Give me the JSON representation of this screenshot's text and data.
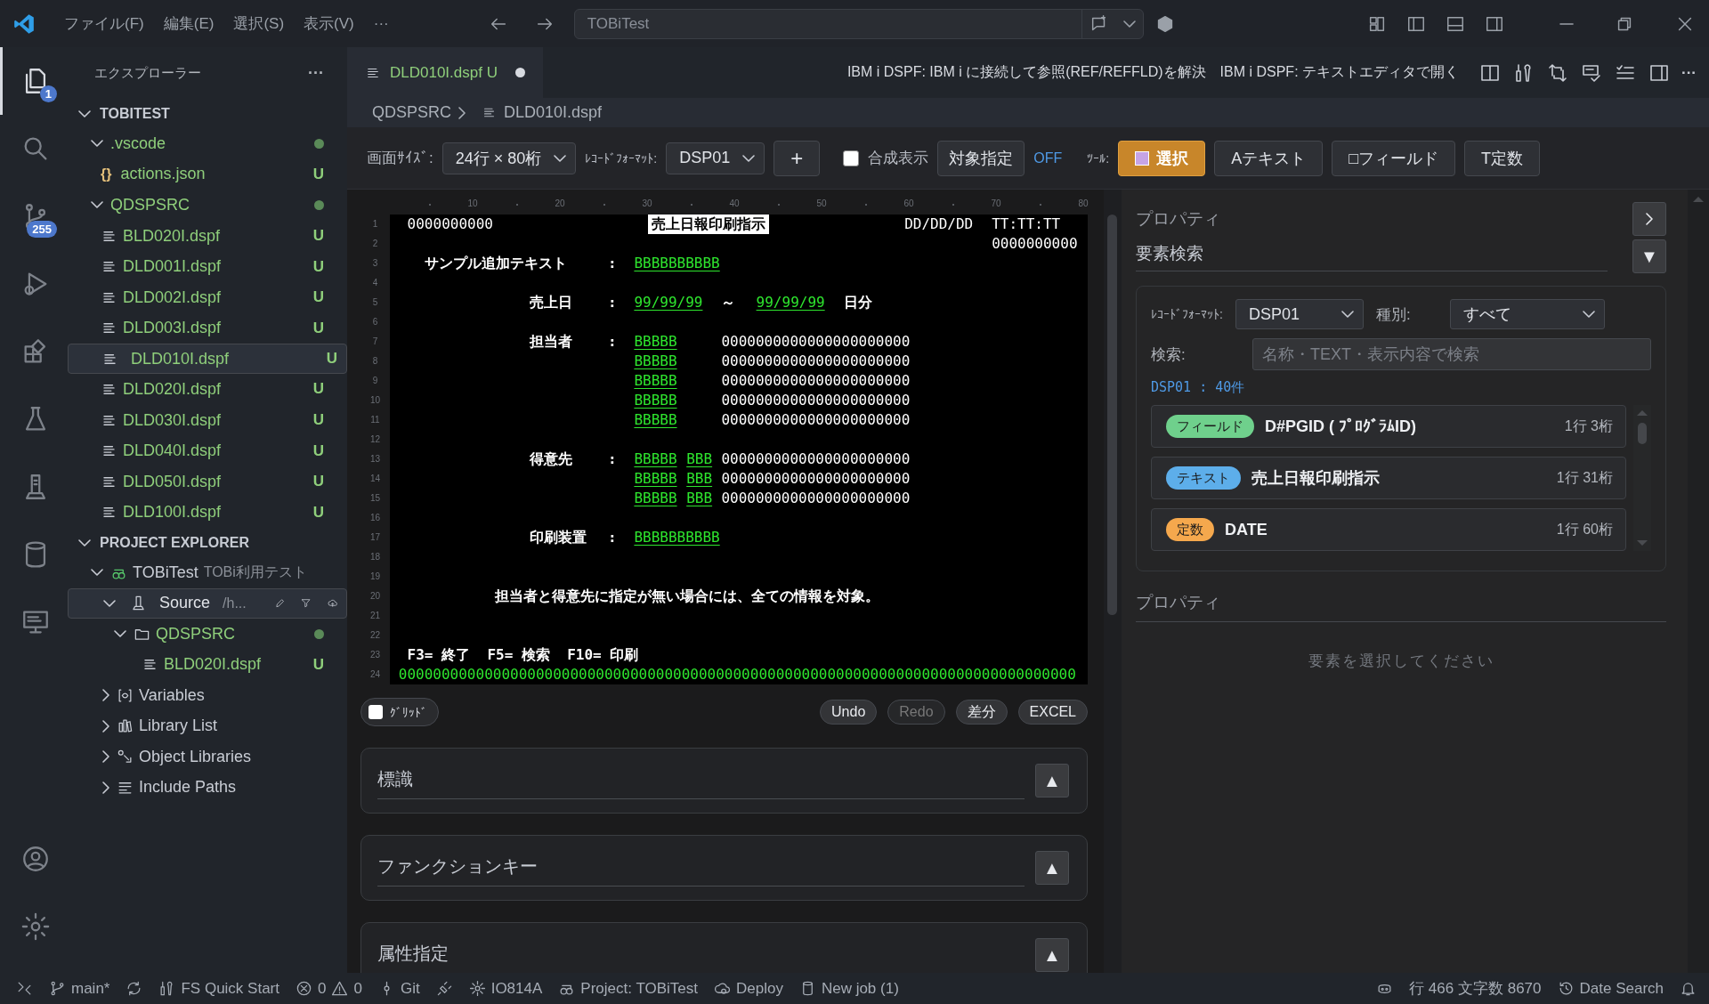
{
  "title_bar": {
    "menus": [
      "ファイル(F)",
      "編集(E)",
      "選択(S)",
      "表示(V)"
    ],
    "more": "···",
    "command_center": "TOBiTest"
  },
  "activity_bar": {
    "items": [
      {
        "selected": true,
        "badge": "1"
      },
      {
        "selected": false
      },
      {
        "selected": false,
        "badge": "255"
      },
      {
        "selected": false
      },
      {
        "selected": false
      },
      {
        "selected": false
      },
      {
        "selected": false
      },
      {
        "selected": false
      },
      {
        "selected": false
      }
    ]
  },
  "sidebar": {
    "title": "エクスプローラー",
    "more": "···",
    "sections": [
      {
        "title": "TOBITEST",
        "kind": "files",
        "expanded": true,
        "items": [
          {
            "label": ".vscode",
            "kind": "folder",
            "expanded": true,
            "dot": true,
            "selected": false,
            "children": [
              {
                "label": "actions.json",
                "kind": "json",
                "glyph": "{}",
                "badge": "U",
                "selected": false
              }
            ]
          },
          {
            "label": "QDSPSRC",
            "kind": "folder",
            "expanded": true,
            "dot": true,
            "selected": false,
            "children": [
              {
                "label": "BLD020I.dspf",
                "kind": "file",
                "badge": "U",
                "selected": false
              },
              {
                "label": "DLD001I.dspf",
                "kind": "file",
                "badge": "U",
                "selected": false
              },
              {
                "label": "DLD002I.dspf",
                "kind": "file",
                "badge": "U",
                "selected": false
              },
              {
                "label": "DLD003I.dspf",
                "kind": "file",
                "badge": "U",
                "selected": false
              },
              {
                "label": "DLD010I.dspf",
                "kind": "file",
                "badge": "U",
                "selected": true
              },
              {
                "label": "DLD020I.dspf",
                "kind": "file",
                "badge": "U",
                "selected": false
              },
              {
                "label": "DLD030I.dspf",
                "kind": "file",
                "badge": "U",
                "selected": false
              },
              {
                "label": "DLD040I.dspf",
                "kind": "file",
                "badge": "U",
                "selected": false
              },
              {
                "label": "DLD050I.dspf",
                "kind": "file",
                "badge": "U",
                "selected": false
              },
              {
                "label": "DLD100I.dspf",
                "kind": "file",
                "badge": "U",
                "selected": false
              }
            ]
          }
        ]
      },
      {
        "title": "PROJECT EXPLORER",
        "kind": "project",
        "expanded": true,
        "items": [
          {
            "label": "TOBiTest",
            "description": "TOBi利用テスト",
            "kind": "project",
            "expanded": true,
            "selected": false,
            "children": [
              {
                "label": "Source",
                "description": "/h...",
                "kind": "source",
                "expanded": true,
                "selected": true,
                "actions": true,
                "children": [
                  {
                    "label": "QDSPSRC",
                    "kind": "folder",
                    "expanded": true,
                    "dot": true,
                    "selected": false,
                    "children": [
                      {
                        "label": "BLD020I.dspf",
                        "kind": "file",
                        "badge": "U",
                        "selected": false
                      }
                    ]
                  }
                ]
              },
              {
                "label": "Variables",
                "kind": "variables",
                "expanded": false,
                "selected": false
              },
              {
                "label": "Library List",
                "kind": "library",
                "expanded": false,
                "selected": false
              },
              {
                "label": "Object Libraries",
                "kind": "objects",
                "expanded": false,
                "selected": false
              },
              {
                "label": "Include Paths",
                "kind": "include",
                "expanded": false,
                "selected": false
              }
            ]
          }
        ]
      }
    ]
  },
  "editor_tab": {
    "label": "DLD010I.dspf",
    "badge": "U",
    "modified": true,
    "selected": true
  },
  "editor_actions": [
    "IBM i DSPF: IBM i に接続して参照(REF/REFFLD)を解決",
    "IBM i DSPF: テキストエディタで開く"
  ],
  "editor_more": "···",
  "breadcrumb": [
    "QDSPSRC",
    "DLD010I.dspf"
  ],
  "toolbar": {
    "screen_size_label": "画面ｻｲｽﾞ:",
    "screen_size": "24行 × 80桁",
    "record_format_label": "ﾚｺｰﾄﾞﾌｫｰﾏｯﾄ:",
    "record_format": "DSP01",
    "add": "+",
    "composite": {
      "label": "合成表示",
      "checked": false
    },
    "target_button": "対象指定",
    "target_state": "OFF",
    "tools_label": "ﾂｰﾙ:",
    "tools": [
      {
        "label": "選択",
        "kind": "select",
        "selected": true
      },
      {
        "label": "テキスト",
        "kind": "text",
        "glyph": "A",
        "selected": false
      },
      {
        "label": "フィールド",
        "kind": "field",
        "glyph": "□",
        "selected": false
      },
      {
        "label": "定数",
        "kind": "constant",
        "glyph": "T",
        "selected": false
      }
    ]
  },
  "screen": {
    "ruler": [
      "10",
      "20",
      "30",
      "40",
      "50",
      "60",
      "70",
      "80"
    ],
    "line_numbers": [
      "1",
      "2",
      "3",
      "4",
      "5",
      "6",
      "7",
      "8",
      "9",
      "10",
      "11",
      "12",
      "13",
      "14",
      "15",
      "16",
      "17",
      "18",
      "19",
      "20",
      "21",
      "22",
      "23",
      "24"
    ],
    "fields": [
      {
        "kind": "output",
        "text": "0000000000"
      },
      {
        "kind": "reverse",
        "text": "売上日報印刷指示"
      },
      {
        "kind": "output",
        "text": "DD/DD/DD"
      },
      {
        "kind": "output",
        "text": "TT:TT:TT"
      },
      {
        "kind": "output",
        "text": "0000000000"
      },
      {
        "kind": "constant",
        "text": "サンプル追加テキスト"
      },
      {
        "kind": "constant",
        "text": ":"
      },
      {
        "kind": "input",
        "text": "BBBBBBBBBB"
      },
      {
        "kind": "constant",
        "text": "売上日"
      },
      {
        "kind": "constant",
        "text": ":"
      },
      {
        "kind": "input",
        "text": "99/99/99"
      },
      {
        "kind": "constant",
        "text": "～"
      },
      {
        "kind": "input",
        "text": "99/99/99"
      },
      {
        "kind": "constant",
        "text": "日分"
      },
      {
        "kind": "constant",
        "text": "担当者"
      },
      {
        "kind": "constant",
        "text": ":"
      },
      {
        "kind": "input",
        "text": "BBBBB"
      },
      {
        "kind": "output",
        "text": "0000000000000000000000"
      },
      {
        "kind": "input",
        "text": "BBBBB"
      },
      {
        "kind": "output",
        "text": "0000000000000000000000"
      },
      {
        "kind": "input",
        "text": "BBBBB"
      },
      {
        "kind": "output",
        "text": "0000000000000000000000"
      },
      {
        "kind": "input",
        "text": "BBBBB"
      },
      {
        "kind": "output",
        "text": "0000000000000000000000"
      },
      {
        "kind": "input",
        "text": "BBBBB"
      },
      {
        "kind": "output",
        "text": "0000000000000000000000"
      },
      {
        "kind": "constant",
        "text": "得意先"
      },
      {
        "kind": "constant",
        "text": ":"
      },
      {
        "kind": "input",
        "text": "BBBBB"
      },
      {
        "kind": "input",
        "text": "BBB"
      },
      {
        "kind": "output",
        "text": "0000000000000000000000"
      },
      {
        "kind": "input",
        "text": "BBBBB"
      },
      {
        "kind": "input",
        "text": "BBB"
      },
      {
        "kind": "output",
        "text": "0000000000000000000000"
      },
      {
        "kind": "input",
        "text": "BBBBB"
      },
      {
        "kind": "input",
        "text": "BBB"
      },
      {
        "kind": "output",
        "text": "0000000000000000000000"
      },
      {
        "kind": "constant",
        "text": "印刷装置"
      },
      {
        "kind": "constant",
        "text": ":"
      },
      {
        "kind": "input",
        "text": "BBBBBBBBBB"
      },
      {
        "kind": "constant",
        "text": "担当者と得意先に指定が無い場合には、全ての情報を対象。"
      },
      {
        "kind": "constant",
        "text": "F3= 終了  F5= 検索  F10= 印刷"
      },
      {
        "kind": "message",
        "text": "0000000000000000000000000000000000000000000000000000000000000000000000000000000"
      }
    ]
  },
  "canvas_bar": {
    "grid": {
      "label": "ｸﾞﾘｯﾄﾞ",
      "checked": false
    },
    "actions": [
      {
        "label": "Undo",
        "disabled": false
      },
      {
        "label": "Redo",
        "disabled": true
      },
      {
        "label": "差分",
        "disabled": false
      },
      {
        "label": "EXCEL",
        "disabled": false
      }
    ]
  },
  "sections": [
    {
      "title": "標識",
      "toggle": "▲"
    },
    {
      "title": "ファンクションキー",
      "toggle": "▲"
    },
    {
      "title": "属性指定",
      "toggle": "▲"
    }
  ],
  "right_panel": {
    "title": "プロパティ",
    "search_title": "要素検索",
    "search_toggle": "▼",
    "record_format_label": "ﾚｺｰﾄﾞﾌｫｰﾏｯﾄ:",
    "record_format": "DSP01",
    "type_label": "種別:",
    "type": "すべて",
    "search_label": "検索:",
    "search_placeholder": "名称・TEXT・表示内容で検索",
    "count": "DSP01 : 40件",
    "results": [
      {
        "tag": "フィールド",
        "color": "#6fd08c",
        "name": "D#PGID ( ﾌﾟﾛｸﾞﾗﾑID)",
        "position": "1行 3桁"
      },
      {
        "tag": "テキスト",
        "color": "#5daeea",
        "name": "売上日報印刷指示",
        "position": "1行 31桁"
      },
      {
        "tag": "定数",
        "color": "#f5a84d",
        "name": "DATE",
        "position": "1行 60桁"
      }
    ],
    "properties_title": "プロパティ",
    "empty_message": "要素を選択してください"
  },
  "status_bar": {
    "left": [
      {
        "kind": "remote"
      },
      {
        "kind": "branch",
        "text": "main*"
      },
      {
        "kind": "sync"
      },
      {
        "kind": "tools",
        "text": "FS Quick Start"
      },
      {
        "kind": "problems",
        "errors": "0",
        "warnings": "0"
      },
      {
        "kind": "git",
        "text": "Git"
      },
      {
        "kind": "plug"
      },
      {
        "kind": "gear",
        "text": "IO814A"
      },
      {
        "kind": "project",
        "text": "Project: TOBiTest"
      },
      {
        "kind": "cloud",
        "text": "Deploy"
      },
      {
        "kind": "database",
        "text": "New job (1)"
      }
    ],
    "right": [
      {
        "kind": "copilot"
      },
      {
        "kind": "plain",
        "text": "行 466 文字数 8670"
      },
      {
        "kind": "history",
        "text": "Date Search"
      },
      {
        "kind": "bell"
      }
    ]
  }
}
